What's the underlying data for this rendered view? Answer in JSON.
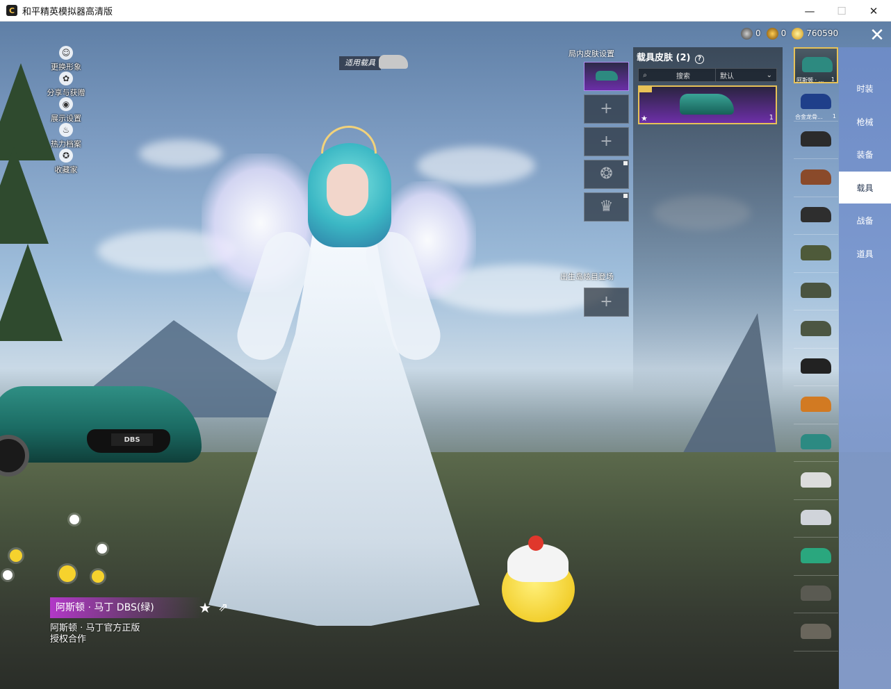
{
  "window": {
    "icon_glyph": "C",
    "title": "和平精英模拟器高清版",
    "minimize_glyph": "—",
    "maximize_glyph": "☐",
    "close_glyph": "✕"
  },
  "left_menu": [
    {
      "icon": "person-icon",
      "glyph": "☺",
      "label": "更换形象"
    },
    {
      "icon": "share-icon",
      "glyph": "✿",
      "label": "分享与获赠"
    },
    {
      "icon": "eye-icon",
      "glyph": "◉",
      "label": "展示设置"
    },
    {
      "icon": "flame-icon",
      "glyph": "♨",
      "label": "热力档案"
    },
    {
      "icon": "collector-icon",
      "glyph": "✪",
      "label": "收藏家"
    }
  ],
  "applied_vehicle_label": "适用载具",
  "currency": [
    {
      "icon": "silver-coin-icon",
      "value": "0"
    },
    {
      "icon": "gold-coin-icon",
      "value": "0"
    },
    {
      "icon": "uc-coin-icon",
      "value": "760590"
    }
  ],
  "close_glyph": "✕",
  "in_game_skin_settings_title": "局内皮肤设置",
  "slots": [
    {
      "name": "selected-skin-slot",
      "glyph": ""
    },
    {
      "name": "empty-slot-1",
      "glyph": "+"
    },
    {
      "name": "empty-slot-2",
      "glyph": "+"
    },
    {
      "name": "locked-slot-1",
      "glyph": "❂"
    },
    {
      "name": "locked-slot-2",
      "glyph": "♛"
    }
  ],
  "spawn_island_title": "出生岛炫目登场",
  "spawn_slot_glyph": "+",
  "vehicle_skin_panel": {
    "title": "载具皮肤 (2)",
    "help_glyph": "?",
    "search_placeholder": "搜索",
    "sort_label": "默认",
    "sort_glyph": "⌄",
    "card_star": "★",
    "card_count": "1"
  },
  "vehicle_list": [
    {
      "label": "阿斯顿 · ...",
      "count": "1",
      "color": "#2d8a80"
    },
    {
      "label": "合金龙骨...",
      "count": "1",
      "color": "#1f3f8a"
    },
    {
      "label": "",
      "count": "",
      "color": "#2b2b2b"
    },
    {
      "label": "",
      "count": "",
      "color": "#8a4a2a"
    },
    {
      "label": "",
      "count": "",
      "color": "#2e2e2e"
    },
    {
      "label": "",
      "count": "",
      "color": "#4e5a3a"
    },
    {
      "label": "",
      "count": "",
      "color": "#4a5440"
    },
    {
      "label": "",
      "count": "",
      "color": "#4c5642"
    },
    {
      "label": "",
      "count": "",
      "color": "#222222"
    },
    {
      "label": "",
      "count": "",
      "color": "#d27a22"
    },
    {
      "label": "",
      "count": "",
      "color": "#2c8a82"
    },
    {
      "label": "",
      "count": "",
      "color": "#dcdcdc"
    },
    {
      "label": "",
      "count": "",
      "color": "#d0d4da"
    },
    {
      "label": "",
      "count": "",
      "color": "#2aa77e"
    },
    {
      "label": "",
      "count": "",
      "color": "#5a5a52"
    },
    {
      "label": "",
      "count": "",
      "color": "#6a665c"
    }
  ],
  "categories": [
    {
      "label": "时装",
      "active": false
    },
    {
      "label": "枪械",
      "active": false
    },
    {
      "label": "装备",
      "active": false
    },
    {
      "label": "载具",
      "active": true
    },
    {
      "label": "战备",
      "active": false
    },
    {
      "label": "道具",
      "active": false
    }
  ],
  "skin_name": "阿斯顿 · 马丁 DBS(绿)",
  "favorite_glyph": "★",
  "share_glyph": "⇗",
  "license_line1": "阿斯顿 · 马丁官方正版",
  "license_line2": "授权合作",
  "car_plate": "DBS",
  "colors": {
    "accent_gold": "#e8c257",
    "accent_purple": "#b238c8",
    "tab_active_bg": "#ffffff",
    "tab_column_bg": "#8ea5d6"
  }
}
